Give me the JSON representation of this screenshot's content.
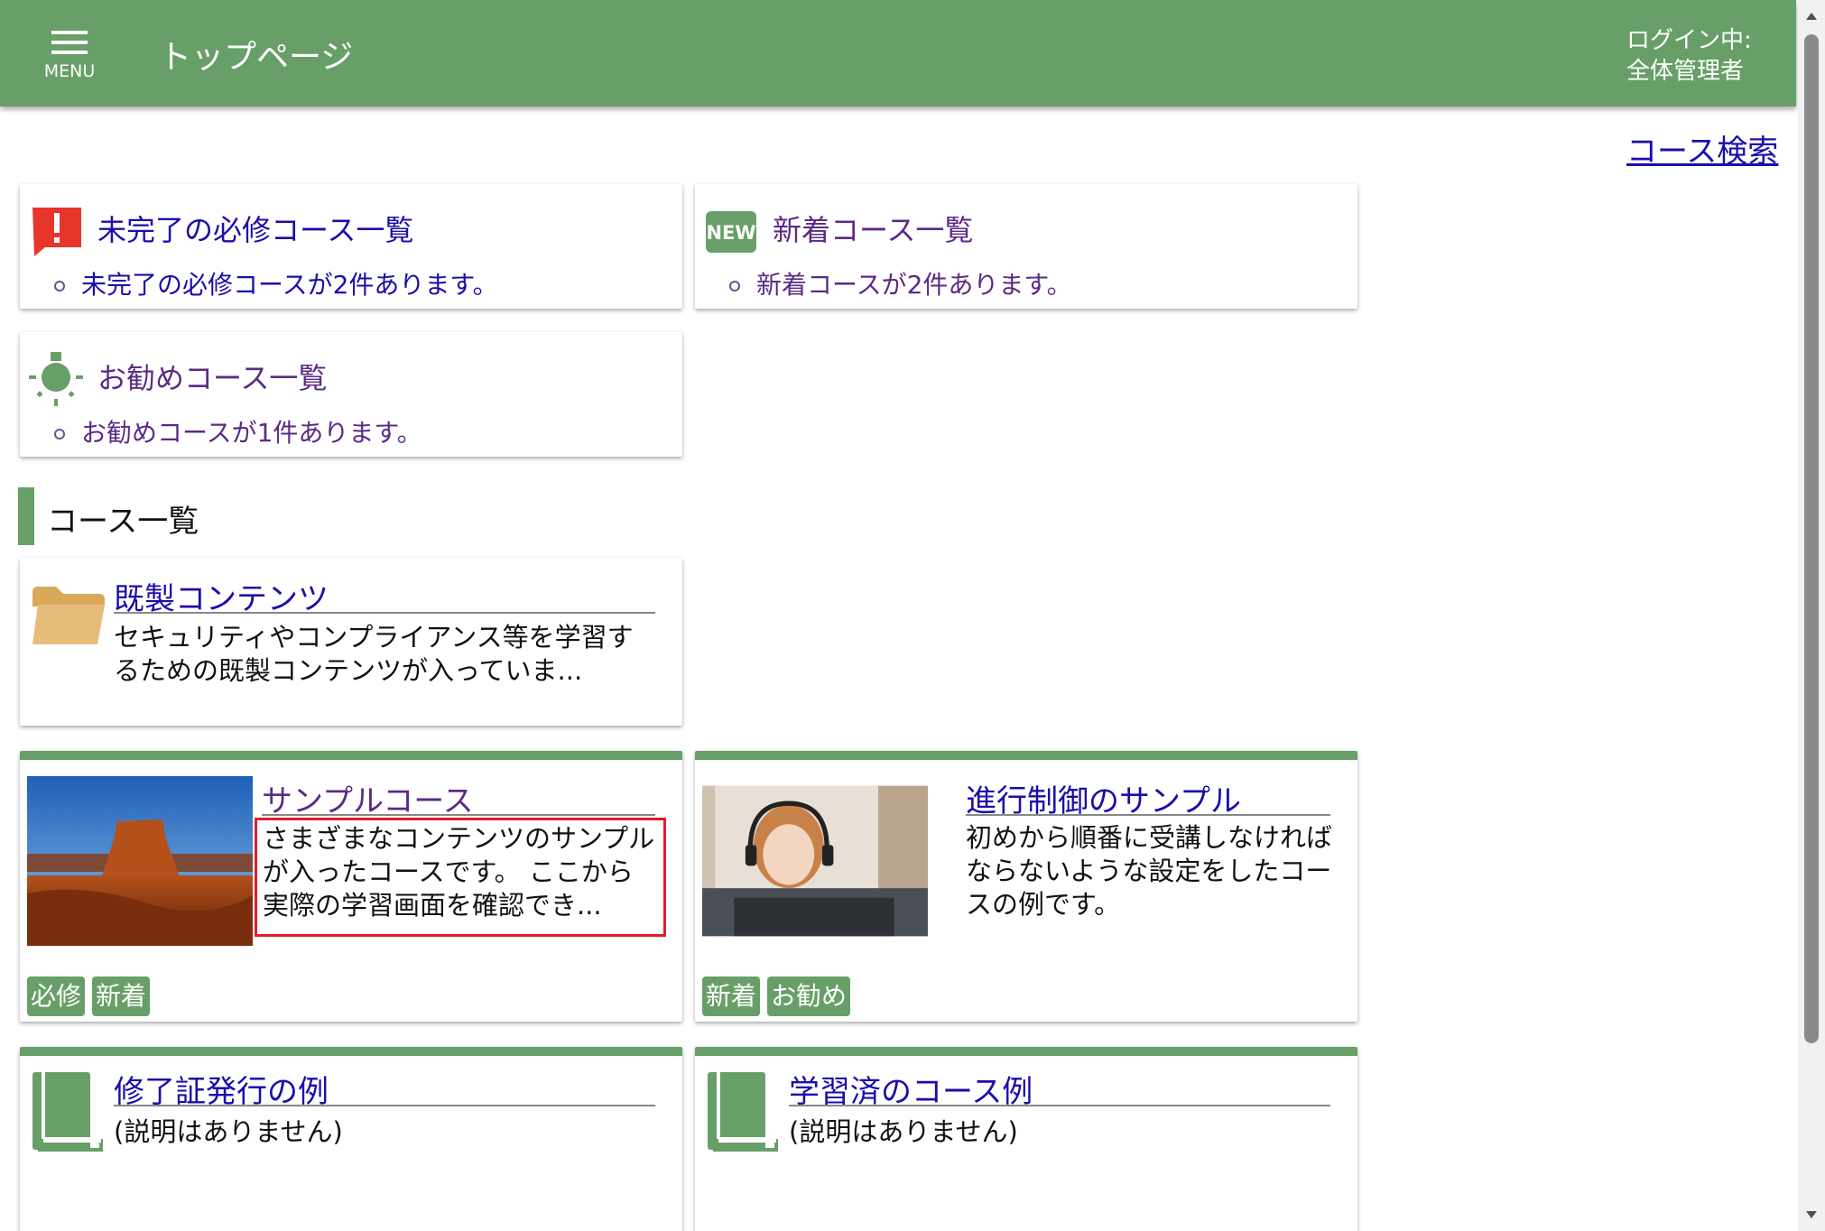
{
  "header": {
    "menu_label": "MENU",
    "title": "トップページ",
    "login_line1": "ログイン中:",
    "login_line2": "全体管理者",
    "color": "#689f68"
  },
  "search_link": "コース検索",
  "summaries": [
    {
      "icon": "alert-icon",
      "title": "未完了の必修コース一覧",
      "item": "未完了の必修コースが2件あります。"
    },
    {
      "icon": "new-icon",
      "icon_text": "NEW",
      "title": "新着コース一覧",
      "item": "新着コースが2件あります。"
    },
    {
      "icon": "lightbulb-icon",
      "title": "お勧めコース一覧",
      "item": "お勧めコースが1件あります。"
    }
  ],
  "section_title": "コース一覧",
  "courses": [
    {
      "icon": "folder-icon",
      "title": "既製コンテンツ",
      "desc": "セキュリティやコンプライアンス等を学習するための既製コンテンツが入っていま..."
    },
    {
      "image": "desert-mesa-image",
      "title": "サンプルコース",
      "desc": "さまざまなコンテンツのサンプルが入ったコースです。 ここから実際の学習画面を確認でき...",
      "tags": [
        "必修",
        "新着"
      ]
    },
    {
      "image": "headset-woman-image",
      "title": "進行制御のサンプル",
      "desc": "初めから順番に受講しなければならないような設定をしたコースの例です。",
      "tags": [
        "新着",
        "お勧め"
      ]
    },
    {
      "icon": "book-icon",
      "title": "修了証発行の例",
      "desc": "(説明はありません)"
    },
    {
      "icon": "book-icon",
      "title": "学習済のコース例",
      "desc": "(説明はありません)"
    }
  ]
}
